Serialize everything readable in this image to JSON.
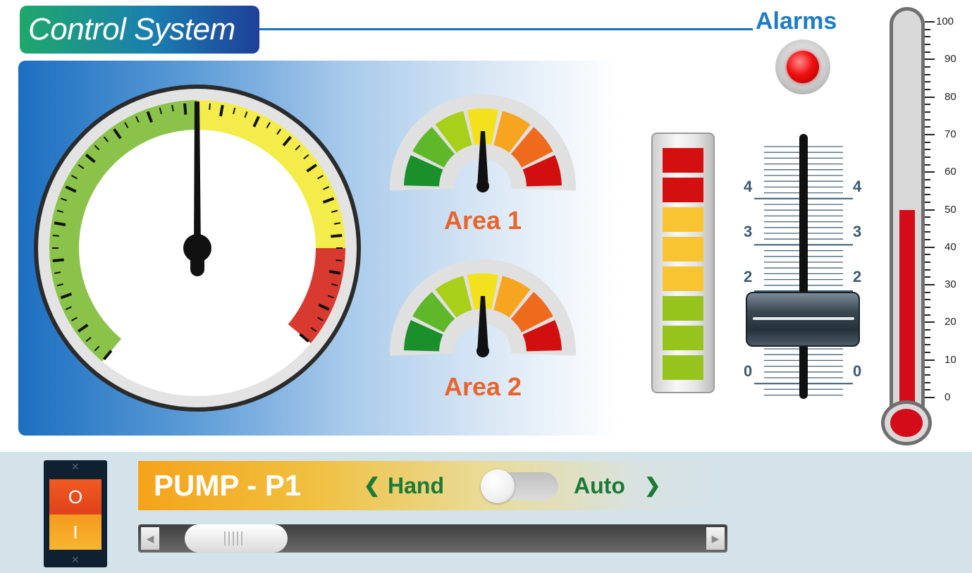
{
  "header": {
    "title": "Control System",
    "alarms_label": "Alarms",
    "alarm_state": "on",
    "alarm_color": "#f01010"
  },
  "main_gauge": {
    "zones": [
      "green",
      "yellow",
      "red"
    ],
    "colors": {
      "green": "#8bc34a",
      "yellow": "#f3ec4a",
      "red": "#d93a2f"
    }
  },
  "area_gauges": [
    {
      "label": "Area 1"
    },
    {
      "label": "Area 2"
    }
  ],
  "level_meter": {
    "segments": [
      "#d40f0f",
      "#d40f0f",
      "#f8c431",
      "#f8c431",
      "#f8c431",
      "#96c41c",
      "#96c41c",
      "#96c41c"
    ]
  },
  "fader": {
    "left_labels": [
      "4",
      "3",
      "2",
      "0"
    ],
    "right_labels": [
      "4",
      "3",
      "2",
      "0"
    ],
    "level": 1.5
  },
  "thermometer": {
    "labels": [
      "100",
      "90",
      "80",
      "70",
      "60",
      "50",
      "40",
      "30",
      "20",
      "10",
      "0"
    ],
    "value": 50,
    "fill_color": "#d40c1a"
  },
  "power_switch": {
    "top_symbol": "O",
    "bottom_symbol": "I"
  },
  "pump": {
    "title": "PUMP - P1",
    "hand_label": "Hand",
    "auto_label": "Auto",
    "hand_chevron": "❮",
    "auto_chevron": "❯",
    "mode_toggle_state": "Hand"
  },
  "scrollbar": {
    "left_arrow": "◀",
    "right_arrow": "▶"
  }
}
